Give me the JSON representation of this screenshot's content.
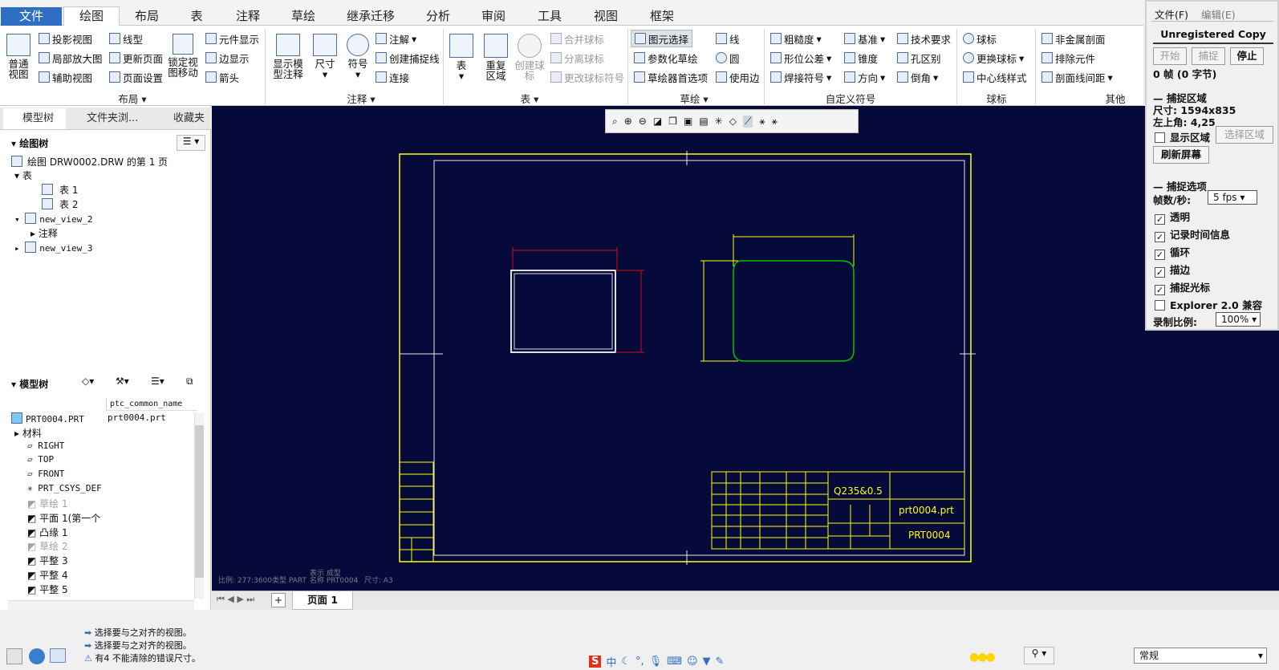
{
  "ribbon_tabs": [
    "文件",
    "绘图",
    "布局",
    "表",
    "注释",
    "草绘",
    "继承迁移",
    "分析",
    "审阅",
    "工具",
    "视图",
    "框架"
  ],
  "layout_group": {
    "big_general": "普通\n视图",
    "items": [
      "投影视图",
      "局部放大图",
      "辅助视图",
      "线型",
      "更新页面",
      "页面设置",
      "元件显示",
      "边显示",
      "箭头"
    ],
    "lock_big": "锁定视\n图移动",
    "label": "布局"
  },
  "annot_group": {
    "show_model": "显示模\n型注释",
    "dimension": "尺寸",
    "symbol": "符号",
    "items": [
      "注解",
      "创建捕捉线",
      "连接"
    ],
    "label": "注释"
  },
  "table_group": {
    "table": "表",
    "repeat": "重复\n区域",
    "create_balloon": "创建球\n标",
    "items": [
      "合并球标",
      "分离球标",
      "更改球标符号"
    ],
    "label": "表"
  },
  "sketch_group": {
    "items": [
      "图元选择",
      "参数化草绘",
      "草绘器首选项",
      "线",
      "圆",
      "使用边"
    ],
    "label": "草绘"
  },
  "custom_sym_group": {
    "items": [
      "粗糙度",
      "形位公差",
      "焊接符号",
      "基准",
      "锥度",
      "方向",
      "技术要求",
      "孔区别",
      "倒角"
    ],
    "label": "自定义符号"
  },
  "balloon_group": {
    "items": [
      "球标",
      "更换球标",
      "中心线样式"
    ],
    "label": "球标"
  },
  "other_group": {
    "items": [
      "非金属剖面",
      "排除元件",
      "剖面线间距"
    ],
    "label": "其他"
  },
  "panel_tabs": [
    "模型树",
    "文件夹浏...",
    "收藏夹"
  ],
  "drawing_tree": {
    "header": "绘图树",
    "items": [
      "绘图 DRW0002.DRW 的第 1 页",
      "表",
      "表 1",
      "表 2",
      "new_view_2",
      "注释",
      "new_view_3"
    ]
  },
  "model_tree": {
    "header": "模型树",
    "column": "ptc_common_name",
    "root": "PRT0004.PRT",
    "root_value": "prt0004.prt",
    "items": [
      "材料",
      "RIGHT",
      "TOP",
      "FRONT",
      "PRT_CSYS_DEF",
      "草绘 1",
      "平面 1(第一个",
      "凸缘 1",
      "草绘 2",
      "平整 3",
      "平整 4",
      "平整 5"
    ]
  },
  "drawing": {
    "info1": "比例: 277:3600类型 PART",
    "info2a": "表示 成型",
    "info2b": "名称 PRT0004",
    "info2c": "尺寸: A3",
    "material": "Q235&0.5",
    "part_file": "prt0004.prt",
    "part_name": "PRT0004"
  },
  "page_tab": "页面 1",
  "messages": [
    "选择要与之对齐的视图。",
    "选择要与之对齐的视图。",
    "有4 不能清除的错误尺寸。"
  ],
  "status_combo": "常规",
  "capture_tool": {
    "menu": [
      "文件(F)",
      "编辑(E)"
    ],
    "banner": "Unregistered Copy",
    "buttons": [
      "开始",
      "捕捉",
      "停止"
    ],
    "frames": "0 帧 (0 字节)",
    "region_title": "捕捉区域",
    "size": "尺寸: 1594x835",
    "top_left": "左上角: 4,25",
    "show_region": "显示区域",
    "select_region": "选择区域",
    "refresh": "刷新屏幕",
    "options_title": "捕捉选项",
    "fps_label": "帧数/秒:",
    "fps_value": "5 fps",
    "options": [
      "透明",
      "记录时间信息",
      "循环",
      "描边",
      "捕捉光标",
      "Explorer 2.0 兼容"
    ],
    "ratio_label": "录制比例:",
    "ratio_value": "100%"
  },
  "colors": {
    "canvas": "#050a3a",
    "frame": "#ffff00",
    "view2": "#00c000",
    "dim": "#d01010",
    "accent": "#2f6fc3"
  }
}
